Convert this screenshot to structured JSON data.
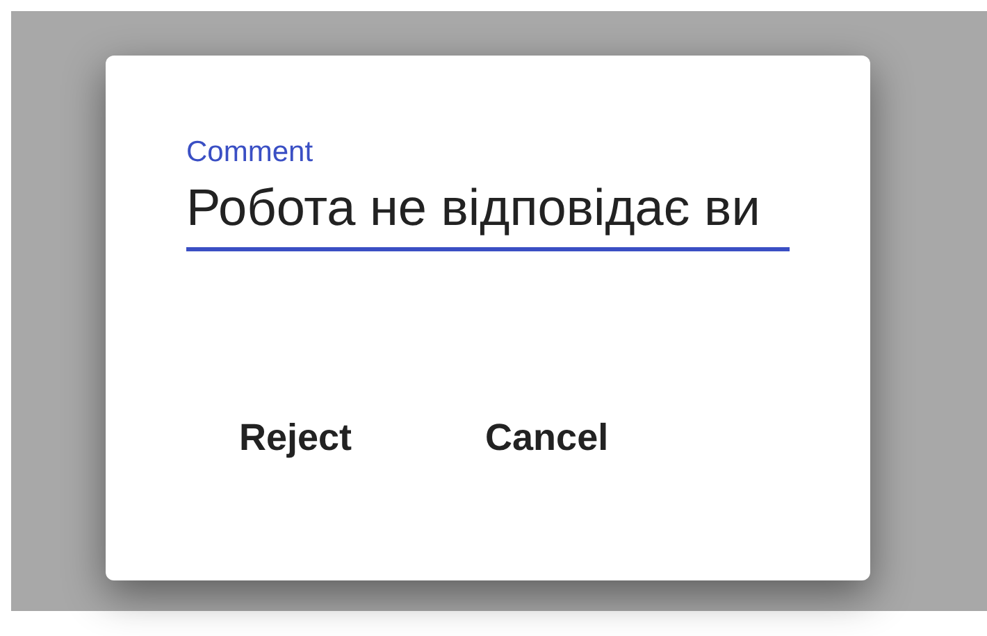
{
  "dialog": {
    "field": {
      "label": "Comment",
      "value": "Робота не відповідає ви",
      "focused": true
    },
    "buttons": [
      {
        "label": "Reject"
      },
      {
        "label": "Cancel"
      }
    ]
  }
}
